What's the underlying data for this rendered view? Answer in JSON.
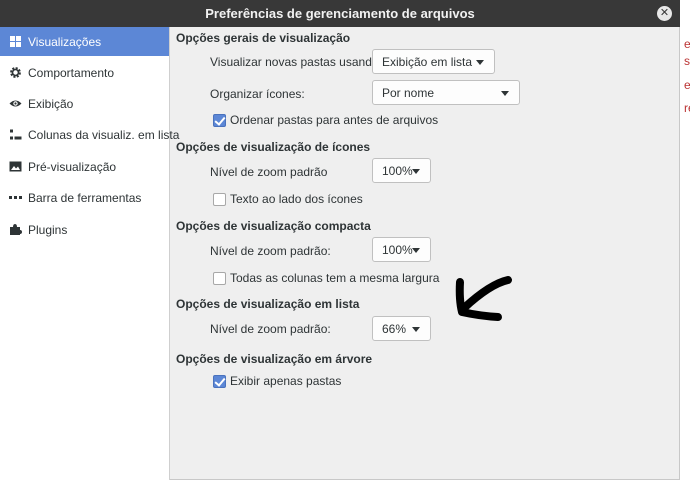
{
  "window": {
    "title": "Preferências de gerenciamento de arquivos",
    "close_glyph": "✕"
  },
  "sidebar": {
    "items": [
      {
        "label": "Visualizações",
        "icon": "grid-icon",
        "active": true
      },
      {
        "label": "Comportamento",
        "icon": "gear-icon",
        "active": false
      },
      {
        "label": "Exibição",
        "icon": "eye-icon",
        "active": false
      },
      {
        "label": "Colunas da visualiz. em lista",
        "icon": "list-icon",
        "active": false
      },
      {
        "label": "Pré-visualização",
        "icon": "image-icon",
        "active": false
      },
      {
        "label": "Barra de ferramentas",
        "icon": "dots-icon",
        "active": false
      },
      {
        "label": "Plugins",
        "icon": "puzzle-icon",
        "active": false
      }
    ]
  },
  "general": {
    "title": "Opções gerais de visualização",
    "new_folders_label": "Visualizar novas pastas usando:",
    "new_folders_value": "Exibição em lista",
    "sort_label": "Organizar ícones:",
    "sort_value": "Por nome",
    "folders_first_label": "Ordenar pastas para antes de arquivos",
    "folders_first_checked": true
  },
  "icon_view": {
    "title": "Opções de visualização de ícones",
    "zoom_label": "Nível de zoom padrão",
    "zoom_value": "100%",
    "text_beside_label": "Texto ao lado dos ícones",
    "text_beside_checked": false
  },
  "compact_view": {
    "title": "Opções de visualização compacta",
    "zoom_label": "Nível de zoom padrão:",
    "zoom_value": "100%",
    "same_width_label": "Todas as colunas tem a mesma largura",
    "same_width_checked": false
  },
  "list_view": {
    "title": "Opções de visualização em lista",
    "zoom_label": "Nível de zoom padrão:",
    "zoom_value": "66%"
  },
  "tree_view": {
    "title": "Opções de visualização em árvore",
    "folders_only_label": "Exibir apenas pastas",
    "folders_only_checked": true
  },
  "background_fragments": [
    "e",
    "s",
    "e",
    "re"
  ],
  "colors": {
    "accent": "#5c87d6",
    "titlebar": "#383838"
  }
}
